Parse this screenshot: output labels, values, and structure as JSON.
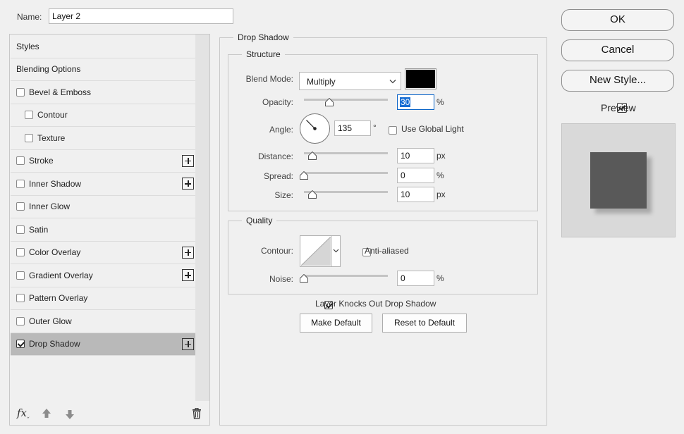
{
  "name_field": {
    "label": "Name:",
    "value": "Layer 2"
  },
  "styles_list": [
    {
      "label": "Styles",
      "checkbox": false,
      "checked": false,
      "plus": false,
      "indent": false,
      "selected": false
    },
    {
      "label": "Blending Options",
      "checkbox": false,
      "checked": false,
      "plus": false,
      "indent": false,
      "selected": false
    },
    {
      "label": "Bevel & Emboss",
      "checkbox": true,
      "checked": false,
      "plus": false,
      "indent": false,
      "selected": false
    },
    {
      "label": "Contour",
      "checkbox": true,
      "checked": false,
      "plus": false,
      "indent": true,
      "selected": false
    },
    {
      "label": "Texture",
      "checkbox": true,
      "checked": false,
      "plus": false,
      "indent": true,
      "selected": false
    },
    {
      "label": "Stroke",
      "checkbox": true,
      "checked": false,
      "plus": true,
      "indent": false,
      "selected": false
    },
    {
      "label": "Inner Shadow",
      "checkbox": true,
      "checked": false,
      "plus": true,
      "indent": false,
      "selected": false
    },
    {
      "label": "Inner Glow",
      "checkbox": true,
      "checked": false,
      "plus": false,
      "indent": false,
      "selected": false
    },
    {
      "label": "Satin",
      "checkbox": true,
      "checked": false,
      "plus": false,
      "indent": false,
      "selected": false
    },
    {
      "label": "Color Overlay",
      "checkbox": true,
      "checked": false,
      "plus": true,
      "indent": false,
      "selected": false
    },
    {
      "label": "Gradient Overlay",
      "checkbox": true,
      "checked": false,
      "plus": true,
      "indent": false,
      "selected": false
    },
    {
      "label": "Pattern Overlay",
      "checkbox": true,
      "checked": false,
      "plus": false,
      "indent": false,
      "selected": false
    },
    {
      "label": "Outer Glow",
      "checkbox": true,
      "checked": false,
      "plus": false,
      "indent": false,
      "selected": false
    },
    {
      "label": "Drop Shadow",
      "checkbox": true,
      "checked": true,
      "plus": true,
      "indent": false,
      "selected": true
    }
  ],
  "bottom_bar": {
    "fx_label": "fx",
    "icons": [
      "fx-icon",
      "arrow-up-icon",
      "arrow-down-icon",
      "trash-icon"
    ]
  },
  "drop_shadow": {
    "title": "Drop Shadow",
    "structure": {
      "title": "Structure",
      "blend_mode_label": "Blend Mode:",
      "blend_mode_value": "Multiply",
      "shadow_color": "#000000",
      "opacity_label": "Opacity:",
      "opacity_value": "30",
      "opacity_unit": "%",
      "opacity_level": 0.3,
      "angle_label": "Angle:",
      "angle_value": "135",
      "angle_unit": "°",
      "use_global_light_label": "Use Global Light",
      "use_global_light_checked": false,
      "distance_label": "Distance:",
      "distance_value": "10",
      "distance_unit": "px",
      "distance_level": 0.1,
      "spread_label": "Spread:",
      "spread_value": "0",
      "spread_unit": "%",
      "spread_level": 0,
      "size_label": "Size:",
      "size_value": "10",
      "size_unit": "px",
      "size_level": 0.1
    },
    "quality": {
      "title": "Quality",
      "contour_label": "Contour:",
      "anti_aliased_label": "Anti-aliased",
      "anti_aliased_checked": false,
      "noise_label": "Noise:",
      "noise_value": "0",
      "noise_unit": "%",
      "noise_level": 0
    },
    "knockout_label": "Layer Knocks Out Drop Shadow",
    "knockout_checked": true,
    "make_default_label": "Make Default",
    "reset_default_label": "Reset to Default"
  },
  "actions": {
    "ok_label": "OK",
    "cancel_label": "Cancel",
    "new_style_label": "New Style...",
    "preview_label": "Preview",
    "preview_checked": true
  },
  "colors": {
    "selected_row": "#b9b9b9",
    "swatch": "#000000",
    "preview_square": "#595959",
    "preview_bg": "#d9d9d9"
  }
}
